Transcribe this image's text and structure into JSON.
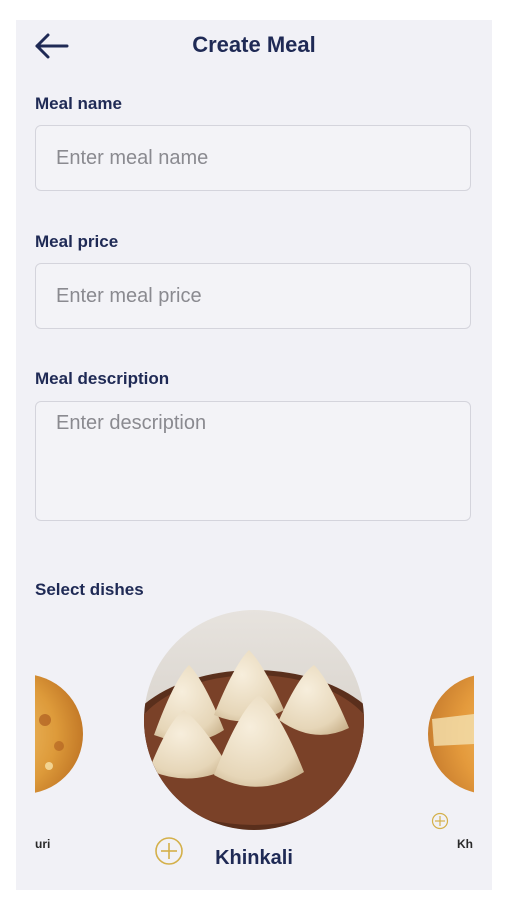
{
  "header": {
    "title": "Create Meal",
    "back_icon": "arrow-left-icon"
  },
  "form": {
    "meal_name": {
      "label": "Meal name",
      "placeholder": "Enter meal name",
      "value": ""
    },
    "meal_price": {
      "label": "Meal price",
      "placeholder": "Enter meal price",
      "value": ""
    },
    "meal_description": {
      "label": "Meal description",
      "placeholder": "Enter description",
      "value": ""
    }
  },
  "dishes": {
    "label": "Select dishes",
    "left_partial_name": "uri",
    "selected_name": "Khinkali",
    "right_partial_name": "Kh"
  },
  "colors": {
    "text_primary": "#1f2a55",
    "accent": "#d4b04a",
    "background": "#f1f1f6"
  }
}
